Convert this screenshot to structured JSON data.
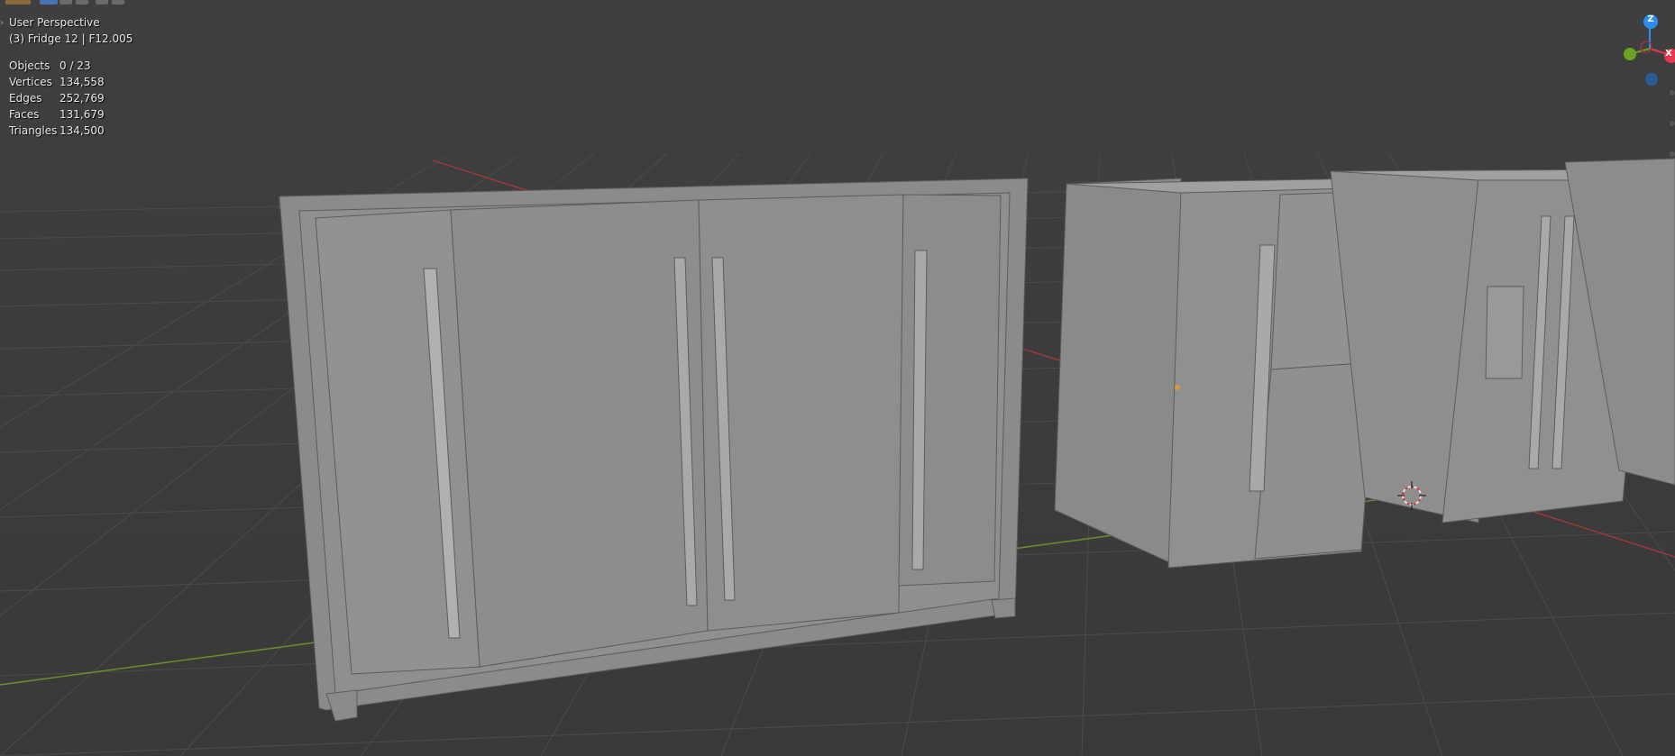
{
  "viewport": {
    "view_name": "User Perspective",
    "active_object": "(3) Fridge 12 | F12.005",
    "stats": [
      {
        "label": "Objects",
        "value": "0 / 23"
      },
      {
        "label": "Vertices",
        "value": "134,558"
      },
      {
        "label": "Edges",
        "value": "252,769"
      },
      {
        "label": "Faces",
        "value": "131,679"
      },
      {
        "label": "Triangles",
        "value": "134,500"
      }
    ]
  },
  "gizmo": {
    "z_label": "Z",
    "x_label": "X",
    "colors": {
      "z": "#2c8ff0",
      "x": "#e8384f",
      "y": "#6ea021",
      "neg_axis": "#2b5a96"
    }
  },
  "colors": {
    "background": "#3d3d3d",
    "grid": "#4a4a4a",
    "x_axis": "#9c3a3a",
    "y_axis": "#6a8f2a",
    "object_fill": "#8e8e8e",
    "object_edge": "#5a5a5a"
  },
  "icons": [
    "expand-arrow-icon",
    "3d-cursor-icon",
    "navigation-gizmo-icon"
  ]
}
